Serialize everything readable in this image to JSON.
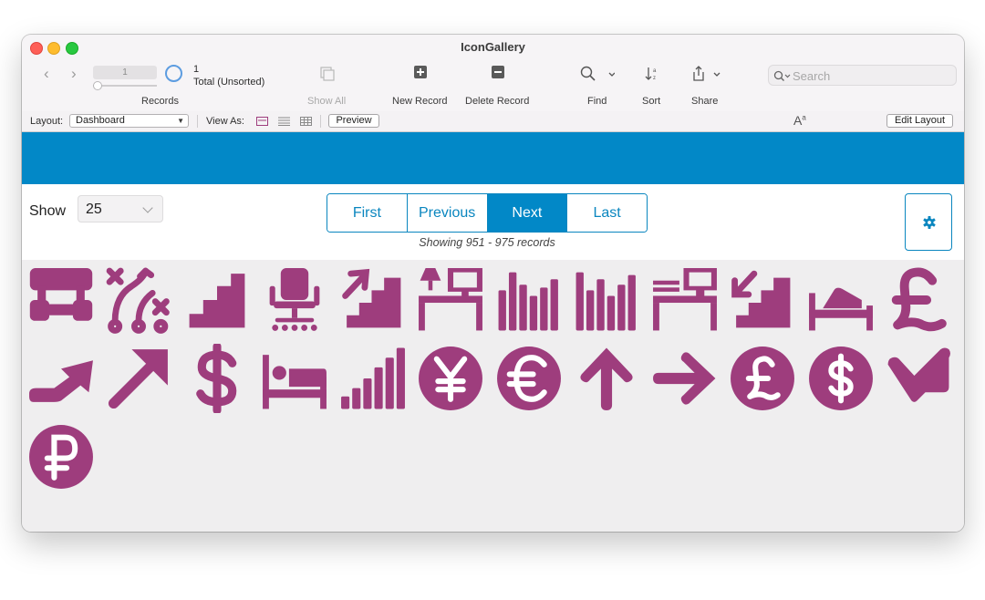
{
  "window": {
    "title": "IconGallery"
  },
  "toolbar": {
    "record_field": "1",
    "record_count": "1",
    "record_total": "Total (Unsorted)",
    "records_label": "Records",
    "show_all_label": "Show All",
    "new_record_label": "New Record",
    "delete_record_label": "Delete Record",
    "find_label": "Find",
    "sort_label": "Sort",
    "share_label": "Share",
    "search_placeholder": "Search"
  },
  "layout_bar": {
    "layout_label": "Layout:",
    "layout_value": "Dashboard",
    "view_as_label": "View As:",
    "preview_label": "Preview",
    "edit_layout_label": "Edit Layout",
    "font_size_glyph": "A",
    "font_size_glyph_small": "a"
  },
  "controls": {
    "show_label": "Show",
    "show_value": "25",
    "pager": [
      "First",
      "Previous",
      "Next",
      "Last"
    ],
    "active_page_button": "Next",
    "showing_text": "Showing 951 - 975 records"
  },
  "colors": {
    "accent": "#0288c7",
    "icon_color": "#9e3d7d"
  },
  "gallery": {
    "icons": [
      "sitemap-icon",
      "tactics-icon",
      "stairs-icon",
      "office-chair-icon",
      "stairs-up-icon",
      "desk-lamp-icon",
      "bar-chart-icon",
      "bar-chart-tall-icon",
      "desk-computer-icon",
      "stairs-down-icon",
      "bed-person-icon",
      "pound-sign-icon",
      "arrow-trend-up-icon",
      "arrow-up-right-icon",
      "dollar-sign-icon",
      "bed-icon",
      "signal-bars-icon",
      "yen-circle-icon",
      "euro-circle-icon",
      "arrow-up-icon",
      "arrow-right-icon",
      "pound-circle-icon",
      "dollar-circle-icon",
      "arrow-down-right-icon",
      "ruble-circle-icon"
    ]
  }
}
